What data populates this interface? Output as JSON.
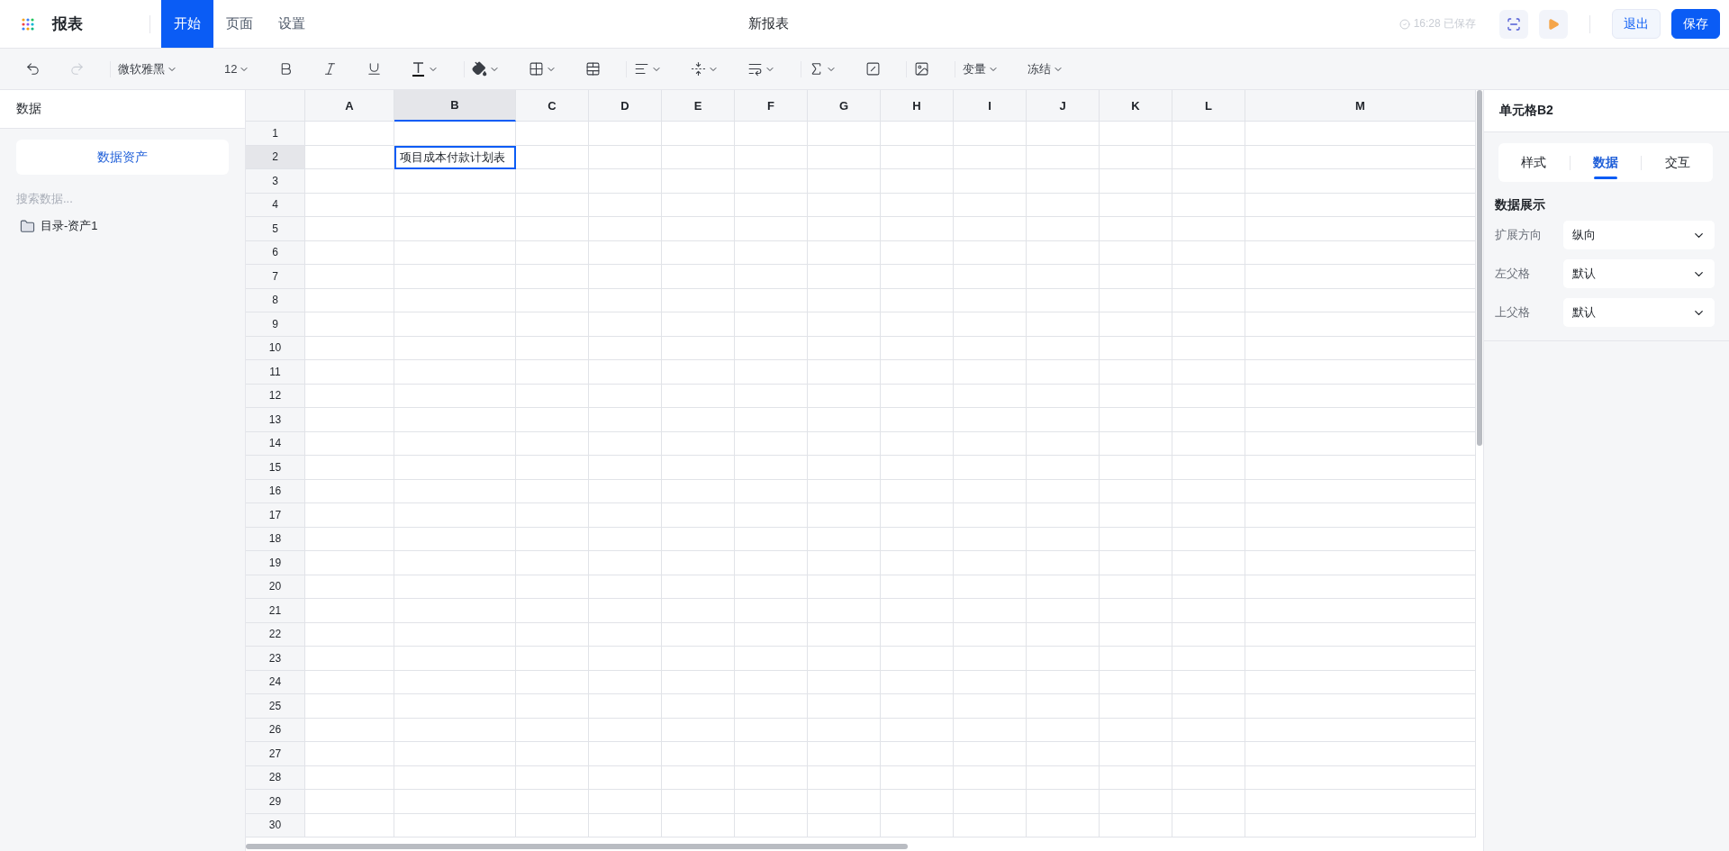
{
  "app": {
    "title": "报表"
  },
  "menu_tabs": [
    {
      "label": "开始",
      "selected": true
    },
    {
      "label": "页面",
      "selected": false
    },
    {
      "label": "设置",
      "selected": false
    }
  ],
  "document_title": "新报表",
  "save_status": "16:28 已保存",
  "header_buttons": [
    {
      "label": "退出",
      "kind": "secondary"
    },
    {
      "label": "保存",
      "kind": "primary"
    }
  ],
  "toolbar": {
    "font": "微软雅黑",
    "size": "12",
    "menus": [
      "变量",
      "冻结"
    ]
  },
  "left_panel": {
    "title": "数据",
    "asset_button": "数据资产",
    "search": {
      "placeholder": "搜索数据..."
    },
    "tree": [
      {
        "label": "目录-资产1"
      }
    ]
  },
  "sheet": {
    "columns": [
      {
        "label": "A",
        "selected": false
      },
      {
        "label": "B",
        "selected": true
      },
      {
        "label": "C",
        "selected": false
      },
      {
        "label": "D",
        "selected": false
      },
      {
        "label": "E",
        "selected": false
      },
      {
        "label": "F",
        "selected": false
      },
      {
        "label": "G",
        "selected": false
      },
      {
        "label": "H",
        "selected": false
      },
      {
        "label": "I",
        "selected": false
      },
      {
        "label": "J",
        "selected": false
      },
      {
        "label": "K",
        "selected": false
      },
      {
        "label": "L",
        "selected": false
      },
      {
        "label": "M",
        "selected": false
      }
    ],
    "rows": [
      {
        "label": "1",
        "selected": false
      },
      {
        "label": "2",
        "selected": true,
        "values": {
          "B": "项目成本付款计划表"
        }
      },
      {
        "label": "3",
        "selected": false
      },
      {
        "label": "4",
        "selected": false
      },
      {
        "label": "5",
        "selected": false
      },
      {
        "label": "6",
        "selected": false
      },
      {
        "label": "7",
        "selected": false
      },
      {
        "label": "8",
        "selected": false
      },
      {
        "label": "9",
        "selected": false
      },
      {
        "label": "10",
        "selected": false
      },
      {
        "label": "11",
        "selected": false
      },
      {
        "label": "12",
        "selected": false
      },
      {
        "label": "13",
        "selected": false
      },
      {
        "label": "14",
        "selected": false
      },
      {
        "label": "15",
        "selected": false
      },
      {
        "label": "16",
        "selected": false
      },
      {
        "label": "17",
        "selected": false
      },
      {
        "label": "18",
        "selected": false
      },
      {
        "label": "19",
        "selected": false
      },
      {
        "label": "20",
        "selected": false
      },
      {
        "label": "21",
        "selected": false
      },
      {
        "label": "22",
        "selected": false
      },
      {
        "label": "23",
        "selected": false
      },
      {
        "label": "24",
        "selected": false
      },
      {
        "label": "25",
        "selected": false
      },
      {
        "label": "26",
        "selected": false
      },
      {
        "label": "27",
        "selected": false
      },
      {
        "label": "28",
        "selected": false
      },
      {
        "label": "29",
        "selected": false
      },
      {
        "label": "30",
        "selected": false
      }
    ]
  },
  "right_panel": {
    "title": "单元格B2",
    "tabs": [
      {
        "label": "样式",
        "selected": false
      },
      {
        "label": "数据",
        "selected": true
      },
      {
        "label": "交互",
        "selected": false
      }
    ],
    "section": "数据展示",
    "fields": [
      {
        "label": "扩展方向",
        "value": "纵向"
      },
      {
        "label": "左父格",
        "value": "默认"
      },
      {
        "label": "上父格",
        "value": "默认"
      }
    ]
  }
}
